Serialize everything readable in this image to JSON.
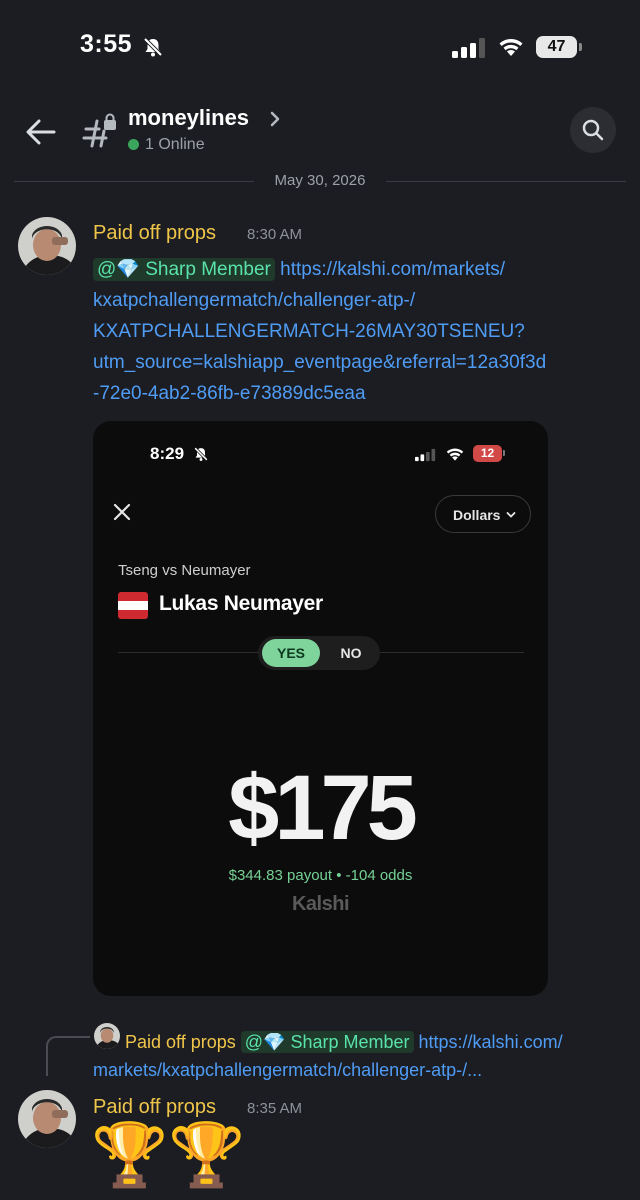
{
  "status_bar": {
    "time": "3:55",
    "battery": "47"
  },
  "header": {
    "channel_name": "moneylines",
    "online_text": "1 Online"
  },
  "date_divider": "May 30, 2026",
  "message1": {
    "author": "Paid off props",
    "time": "8:30 AM",
    "mention": "@💎 Sharp Member",
    "link_lines": [
      "https://kalshi.com/markets/",
      "kxatpchallengermatch/challenger-atp-/",
      "KXATPCHALLENGERMATCH-26MAY30TSENEU?",
      "utm_source=kalshiapp_eventpage&referral=12a30f3d",
      "-72e0-4ab2-86fb-e73889dc5eaa"
    ]
  },
  "embed": {
    "time": "8:29",
    "battery": "12",
    "currency_select": "Dollars",
    "match": "Tseng vs Neumayer",
    "player": "Lukas Neumayer",
    "yes_label": "YES",
    "no_label": "NO",
    "amount": "$175",
    "payout": "$344.83 payout • -104 odds",
    "brand": "Kalshi"
  },
  "reply": {
    "author": "Paid off props",
    "mention": "@💎 Sharp Member",
    "link_line1": "https://kalshi.com/",
    "link_line2": "markets/kxatpchallengermatch/challenger-atp-/..."
  },
  "message2": {
    "author": "Paid off props",
    "time": "8:35 AM",
    "content": "🏆🏆"
  }
}
